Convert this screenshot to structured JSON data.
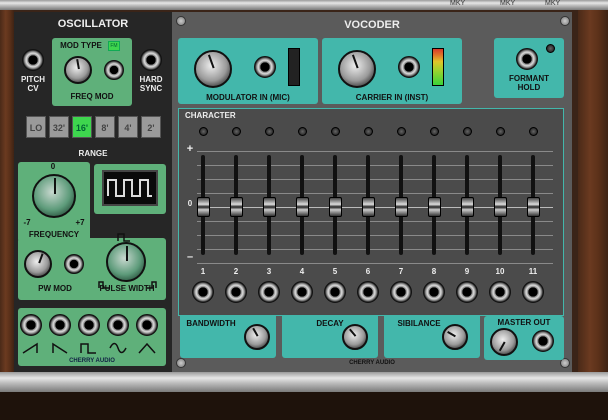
{
  "oscillator": {
    "title": "OSCILLATOR",
    "pitch_cv": "PITCH\nCV",
    "hard_sync": "HARD\nSYNC",
    "mod_type": "MOD TYPE",
    "mod_type_button": "FM",
    "freq_mod": "FREQ MOD",
    "range": {
      "label": "RANGE",
      "options": [
        "LO",
        "32'",
        "16'",
        "8'",
        "4'",
        "2'"
      ],
      "selected": "16'"
    },
    "frequency": {
      "label": "FREQUENCY",
      "top": "0",
      "min": "-7",
      "max": "+7"
    },
    "pw_mod": "PW MOD",
    "pulse_width": "PULSE WIDTH",
    "brand": "CHERRY AUDIO"
  },
  "vocoder": {
    "title": "VOCODER",
    "modulator_in": "MODULATOR IN (MIC)",
    "carrier_in": "CARRIER IN (INST)",
    "formant_hold": "FORMANT\nHOLD",
    "character": "CHARACTER",
    "plus": "+",
    "zero": "0",
    "minus": "–",
    "bands": [
      "1",
      "2",
      "3",
      "4",
      "5",
      "6",
      "7",
      "8",
      "9",
      "10",
      "11"
    ],
    "bandwidth": "BANDWIDTH",
    "decay": "DECAY",
    "sibilance": "SIBILANCE",
    "master_out": "MASTER OUT",
    "brand": "CHERRY AUDIO",
    "carrier_meter_colors": [
      "#3ad33a",
      "#9bd32e",
      "#e0c52a",
      "#e07a2a",
      "#d83a2a"
    ]
  },
  "top_bar": {
    "labels": [
      "MKY",
      "MKY",
      "MKY"
    ]
  }
}
